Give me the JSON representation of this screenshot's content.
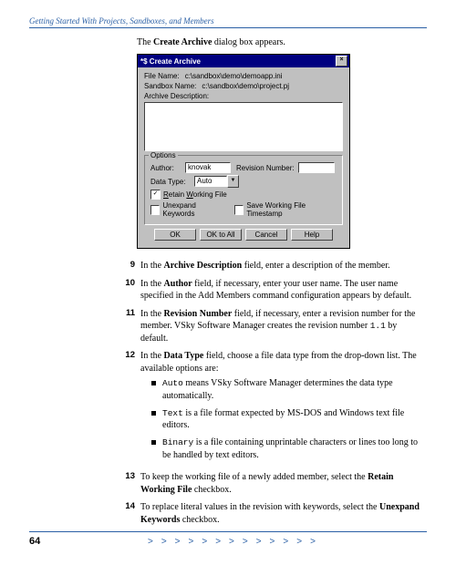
{
  "header": "Getting Started With Projects, Sandboxes, and Members",
  "lead_pre": "The ",
  "lead_bold": "Create Archive",
  "lead_post": " dialog box appears.",
  "dialog": {
    "title": "*$ Create Archive",
    "file_label": "File Name:",
    "file_value": "c:\\sandbox\\demo\\demoapp.ini",
    "sandbox_label": "Sandbox Name:",
    "sandbox_value": "c:\\sandbox\\demo\\project.pj",
    "desc_label": "Archive Description:",
    "group": "Options",
    "author_label": "Author:",
    "author_value": "knovak",
    "rev_label": "Revision Number:",
    "dt_label": "Data Type:",
    "dt_value": "Auto",
    "cb1": "Retain Working File",
    "cb2": "Unexpand Keywords",
    "cb3": "Save Working File Timestamp",
    "b_ok": "OK",
    "b_all": "OK to All",
    "b_cancel": "Cancel",
    "b_help": "Help"
  },
  "steps": [
    {
      "n": "9",
      "parts": [
        [
          "",
          "In the "
        ],
        [
          "b",
          "Archive Description"
        ],
        [
          "",
          " field, enter a description of the member."
        ]
      ]
    },
    {
      "n": "10",
      "parts": [
        [
          "",
          "In the "
        ],
        [
          "b",
          "Author"
        ],
        [
          "",
          " field, if necessary, enter your user name. The user name specified in the Add Members command configuration appears by default."
        ]
      ]
    },
    {
      "n": "11",
      "parts": [
        [
          "",
          "In the "
        ],
        [
          "b",
          "Revision Number"
        ],
        [
          "",
          " field, if necessary, enter a revision number for the member. VSky Software Manager creates the revision number "
        ],
        [
          "m",
          "1.1"
        ],
        [
          "",
          " by default."
        ]
      ]
    },
    {
      "n": "12",
      "parts": [
        [
          "",
          "In the "
        ],
        [
          "b",
          "Data Type"
        ],
        [
          "",
          " field, choose a file data type from the drop-down list. The available options are:"
        ]
      ],
      "bullets": [
        [
          [
            "m",
            "Auto"
          ],
          [
            "",
            " means VSky Software Manager determines the data type automatically."
          ]
        ],
        [
          [
            "m",
            "Text"
          ],
          [
            "",
            " is a file format expected by MS-DOS and Windows text file editors."
          ]
        ],
        [
          [
            "m",
            "Binary"
          ],
          [
            "",
            " is a file containing unprintable characters or lines too long to be handled by text editors."
          ]
        ]
      ]
    },
    {
      "n": "13",
      "parts": [
        [
          "",
          "To keep the working file of a newly added member, select the "
        ],
        [
          "b",
          "Retain Working File"
        ],
        [
          "",
          " checkbox."
        ]
      ]
    },
    {
      "n": "14",
      "parts": [
        [
          "",
          "To replace literal values in the revision with keywords, select the "
        ],
        [
          "b",
          "Unexpand Keywords"
        ],
        [
          "",
          " checkbox."
        ]
      ]
    }
  ],
  "page_num": "64",
  "chevrons": ">>>>>>>>>>>>>"
}
